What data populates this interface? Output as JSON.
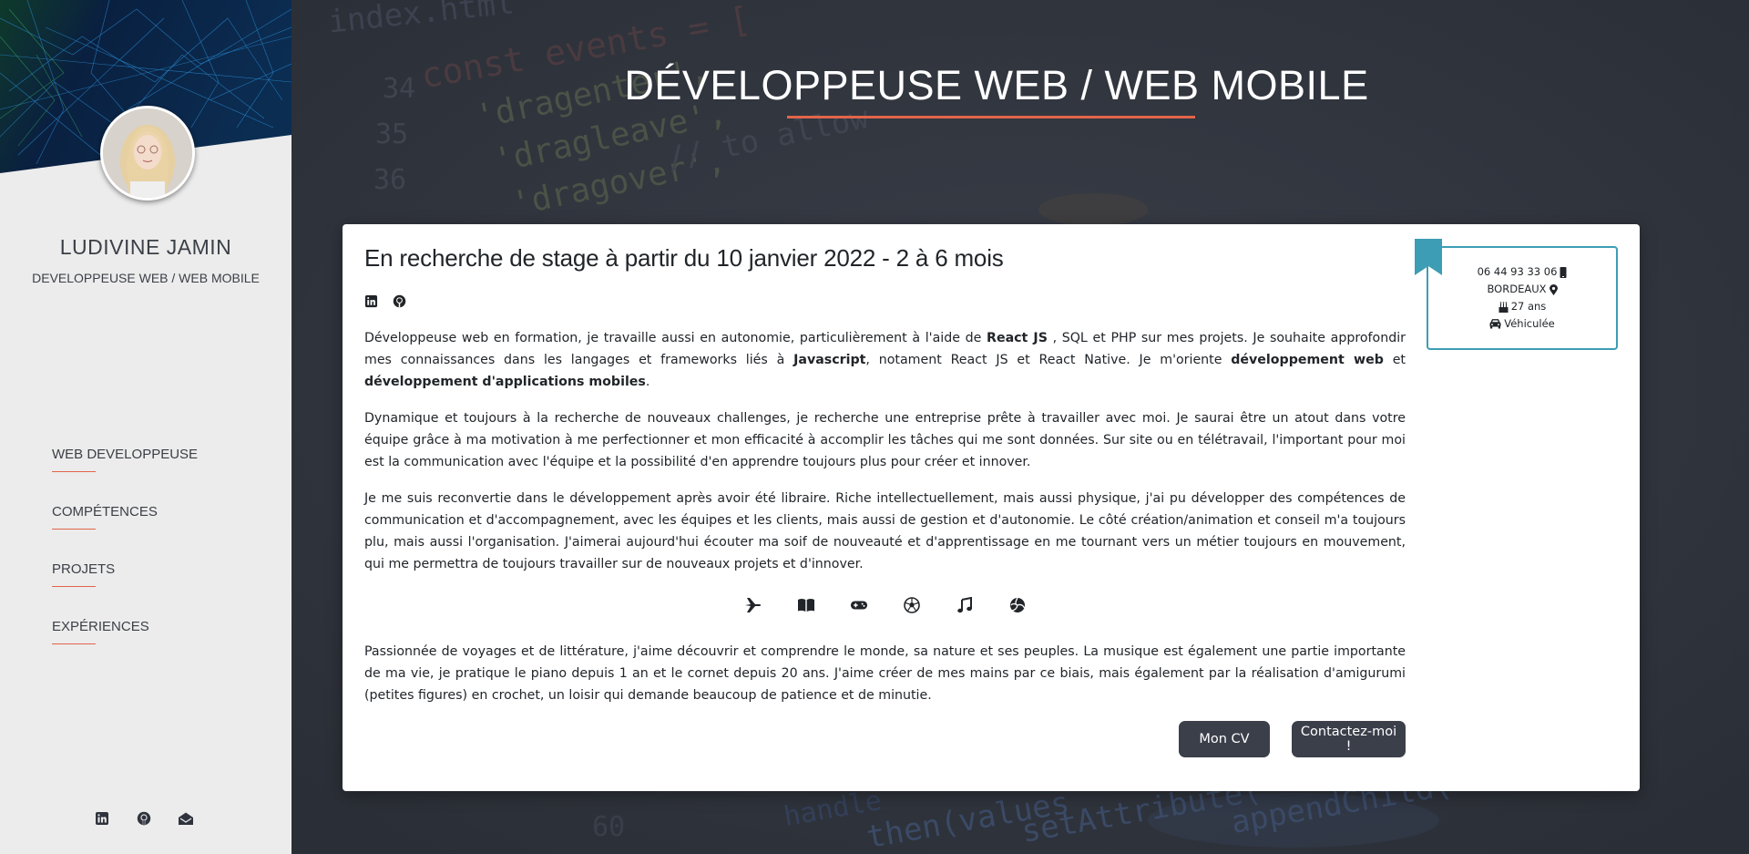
{
  "sidebar": {
    "name": "LUDIVINE JAMIN",
    "role": "DEVELOPPEUSE WEB / WEB MOBILE",
    "nav": [
      {
        "label": "WEB DEVELOPPEUSE"
      },
      {
        "label": "COMPÉTENCES"
      },
      {
        "label": "PROJETS"
      },
      {
        "label": "EXPÉRIENCES"
      }
    ],
    "social_icons": [
      "linkedin-icon",
      "github-icon",
      "envelope-open-icon"
    ]
  },
  "header": {
    "title": "DÉVELOPPEUSE WEB / WEB MOBILE"
  },
  "background_code": [
    "index.html",
    "const events = [",
    "34",
    "35",
    "36",
    "'dragenter',",
    "'dragleave',",
    "'dragover',",
    "// to allow",
    "then(values",
    "setAttribute(",
    "appendChild(",
    "handle",
    "60"
  ],
  "card": {
    "heading": "En recherche de stage à partir du 10 janvier 2022 - 2 à 6 mois",
    "social_icons": [
      "linkedin-icon",
      "github-icon"
    ],
    "intro": {
      "part1": "Développeuse web en formation, je travaille aussi en autonomie, particulièrement à l'aide de ",
      "bold1": "React JS",
      "part2": " , SQL et PHP sur mes projets. Je souhaite approfondir mes connaissances dans les langages et frameworks liés à ",
      "bold2": "Javascript",
      "part3": ", notament React JS et React Native. Je m'oriente ",
      "bold3": "développement web",
      "part4": " et ",
      "bold4": "développement d'applications mobiles",
      "part5": "."
    },
    "paragraph2": "Dynamique et toujours à la recherche de nouveaux challenges, je recherche une entreprise prête à travailler avec moi. Je saurai être un atout dans votre équipe grâce à ma motivation à me perfectionner et mon efficacité à accomplir les tâches qui me sont données. Sur site ou en télétravail, l'important pour moi est la communication avec l'équipe et la possibilité d'en apprendre toujours plus pour créer et innover.",
    "paragraph3": "Je me suis reconvertie dans le développement après avoir été libraire. Riche intellectuellement, mais aussi physique, j'ai pu développer des compétences de communication et d'accompagnement, avec les équipes et les clients, mais aussi de gestion et d'autonomie. Le côté création/animation et conseil m'a toujours plu, mais aussi l'organisation. J'aimerai aujourd'hui écouter ma soif de nouveauté et d'apprentissage en me tournant vers un métier toujours en mouvement, qui me permettra de toujours travailler sur de nouveaux projets et d'innover.",
    "hobby_icons": [
      "plane-icon",
      "book-open-icon",
      "gamepad-icon",
      "football-icon",
      "music-note-icon",
      "volleyball-icon"
    ],
    "paragraph4": "Passionnée de voyages et de littérature, j'aime découvrir et comprendre le monde, sa nature et ses peuples. La musique est également une partie importante de ma vie, je pratique le piano depuis 1 an et le cornet depuis 20 ans. J'aime créer de mes mains par ce biais, mais également par la réalisation d'amigurumi (petites figures) en crochet, un loisir qui demande beaucoup de patience et de minutie.",
    "buttons": {
      "cv": "Mon CV",
      "contact": "Contactez-moi !"
    }
  },
  "info_box": {
    "phone": "06 44 93 33 06",
    "city": "BORDEAUX",
    "age": "27 ans",
    "vehicle": "Véhiculée",
    "icons": [
      "phone-icon",
      "map-marker-icon",
      "birthday-cake-icon",
      "car-icon"
    ]
  },
  "colors": {
    "accent": "#e2644a",
    "teal": "#3d9db4",
    "sidebar_bg": "#ececec",
    "main_bg": "#2f333c",
    "button_bg": "#3b3f4a"
  }
}
